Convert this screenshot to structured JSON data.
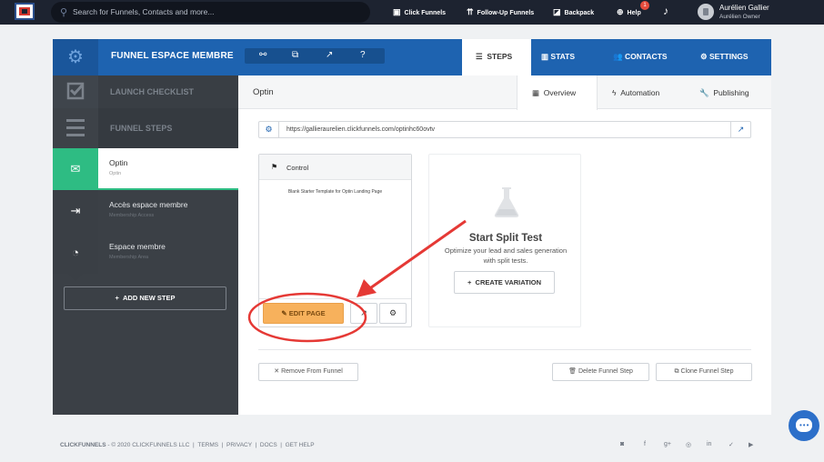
{
  "topbar": {
    "search_placeholder": "Search for Funnels, Contacts and more...",
    "nav": [
      {
        "label": "Click Funnels",
        "icon": "funnels-icon"
      },
      {
        "label": "Follow-Up Funnels",
        "icon": "follow-up-icon"
      },
      {
        "label": "Backpack",
        "icon": "backpack-icon"
      },
      {
        "label": "Help",
        "icon": "help-icon"
      }
    ],
    "help_badge": "1",
    "user": {
      "name": "Aurélien Gallier",
      "role": "Aurélien  Owner"
    }
  },
  "header": {
    "title": "FUNNEL ESPACE MEMBRE",
    "tabs": {
      "steps": "STEPS",
      "stats": "STATS",
      "contacts": "CONTACTS",
      "settings": "SETTINGS"
    }
  },
  "sidebar": {
    "launch_checklist": "LAUNCH CHECKLIST",
    "funnel_steps": "FUNNEL STEPS",
    "steps": [
      {
        "title": "Optin",
        "sub": "Optin"
      },
      {
        "title": "Accès espace membre",
        "sub": "Membership Access"
      },
      {
        "title": "Espace membre",
        "sub": "Membership Area"
      }
    ],
    "add_step": "ADD NEW STEP"
  },
  "main": {
    "page_title": "Optin",
    "subtabs": {
      "overview": "Overview",
      "automation": "Automation",
      "publishing": "Publishing"
    },
    "url": "https://gallieraurelien.clickfunnels.com/optinhc60ovtv",
    "card": {
      "label": "Control",
      "description": "Blank Starter Template for Optin Landing Page",
      "edit_button": "EDIT PAGE"
    },
    "split": {
      "title": "Start Split Test",
      "desc": "Optimize your lead and sales generation with split tests.",
      "button": "CREATE VARIATION"
    },
    "remove": "Remove From Funnel",
    "delete": "Delete Funnel Step",
    "clone": "Clone Funnel Step"
  },
  "footer": {
    "brand": "CLICKFUNNELS",
    "copyright": "- © 2020 CLICKFUNNELS LLC",
    "links": [
      "TERMS",
      "PRIVACY",
      "DOCS",
      "GET HELP"
    ],
    "social": [
      "instagram-icon",
      "facebook-icon",
      "google-plus-icon",
      "instagram-icon",
      "linkedin-icon",
      "twitter-icon",
      "youtube-icon"
    ]
  },
  "colors": {
    "primary": "#1e63b0",
    "active_step": "#2ebc83",
    "edit_button": "#f7b15c",
    "annotation": "#e53935",
    "topbar": "#1d2330",
    "sidebar": "#3b4046"
  }
}
